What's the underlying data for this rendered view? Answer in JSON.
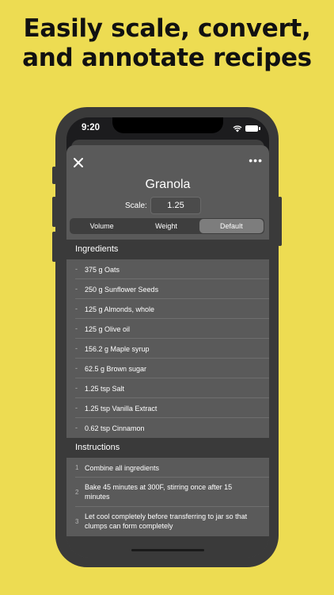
{
  "headline": {
    "line1": "Easily scale, convert,",
    "line2": "and annotate recipes"
  },
  "status_bar": {
    "time": "9:20",
    "icons": [
      "wifi-icon",
      "battery-icon"
    ]
  },
  "recipe": {
    "title": "Granola",
    "scale_label": "Scale:",
    "scale_value": "1.25",
    "units_tabs": [
      {
        "label": "Volume",
        "active": false
      },
      {
        "label": "Weight",
        "active": false
      },
      {
        "label": "Default",
        "active": true
      }
    ],
    "ingredients_header": "Ingredients",
    "ingredients": [
      "375 g Oats",
      "250 g Sunflower Seeds",
      "125 g Almonds, whole",
      "125 g Olive oil",
      "156.2 g Maple syrup",
      "62.5 g Brown sugar",
      "1.25 tsp Salt",
      "1.25 tsp Vanilla Extract",
      "0.62 tsp Cinnamon"
    ],
    "instructions_header": "Instructions",
    "instructions": [
      {
        "num": "1",
        "text": "Combine all ingredients"
      },
      {
        "num": "2",
        "text": "Bake 45 minutes at 300F, stirring once after 15 minutes"
      },
      {
        "num": "3",
        "text": "Let cool completely before transferring to jar so that clumps can form completely"
      }
    ]
  },
  "colors": {
    "background": "#EDDC52",
    "sheet": "#5A5A5A",
    "header": "#3A3A3A",
    "active_tab": "#7D7D7D"
  }
}
